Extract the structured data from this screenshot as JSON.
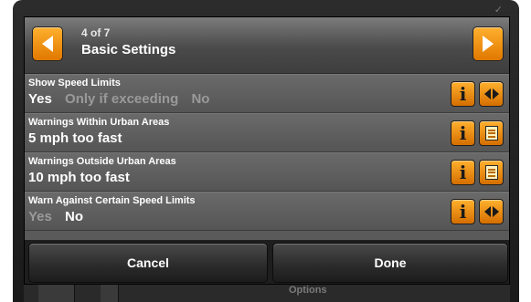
{
  "header": {
    "page_count": "4 of 7",
    "title": "Basic Settings"
  },
  "rows": [
    {
      "label": "Show Speed Limits",
      "options": [
        {
          "text": "Yes",
          "selected": true
        },
        {
          "text": "Only if exceeding",
          "selected": false
        },
        {
          "text": "No",
          "selected": false
        }
      ],
      "action_icon": "toggle-arrows-icon"
    },
    {
      "label": "Warnings Within Urban Areas",
      "value": "5 mph too fast",
      "action_icon": "list-icon"
    },
    {
      "label": "Warnings Outside Urban Areas",
      "value": "10 mph too fast",
      "action_icon": "list-icon"
    },
    {
      "label": "Warn Against Certain Speed Limits",
      "options": [
        {
          "text": "Yes",
          "selected": false
        },
        {
          "text": "No",
          "selected": true
        }
      ],
      "action_icon": "toggle-arrows-icon"
    }
  ],
  "footer": {
    "cancel_label": "Cancel",
    "done_label": "Done"
  },
  "background_bar": {
    "text": "Options"
  },
  "colors": {
    "accent": "#f59a1a",
    "panel": "#5a5a5a",
    "dim_text": "#9a9a9a"
  }
}
